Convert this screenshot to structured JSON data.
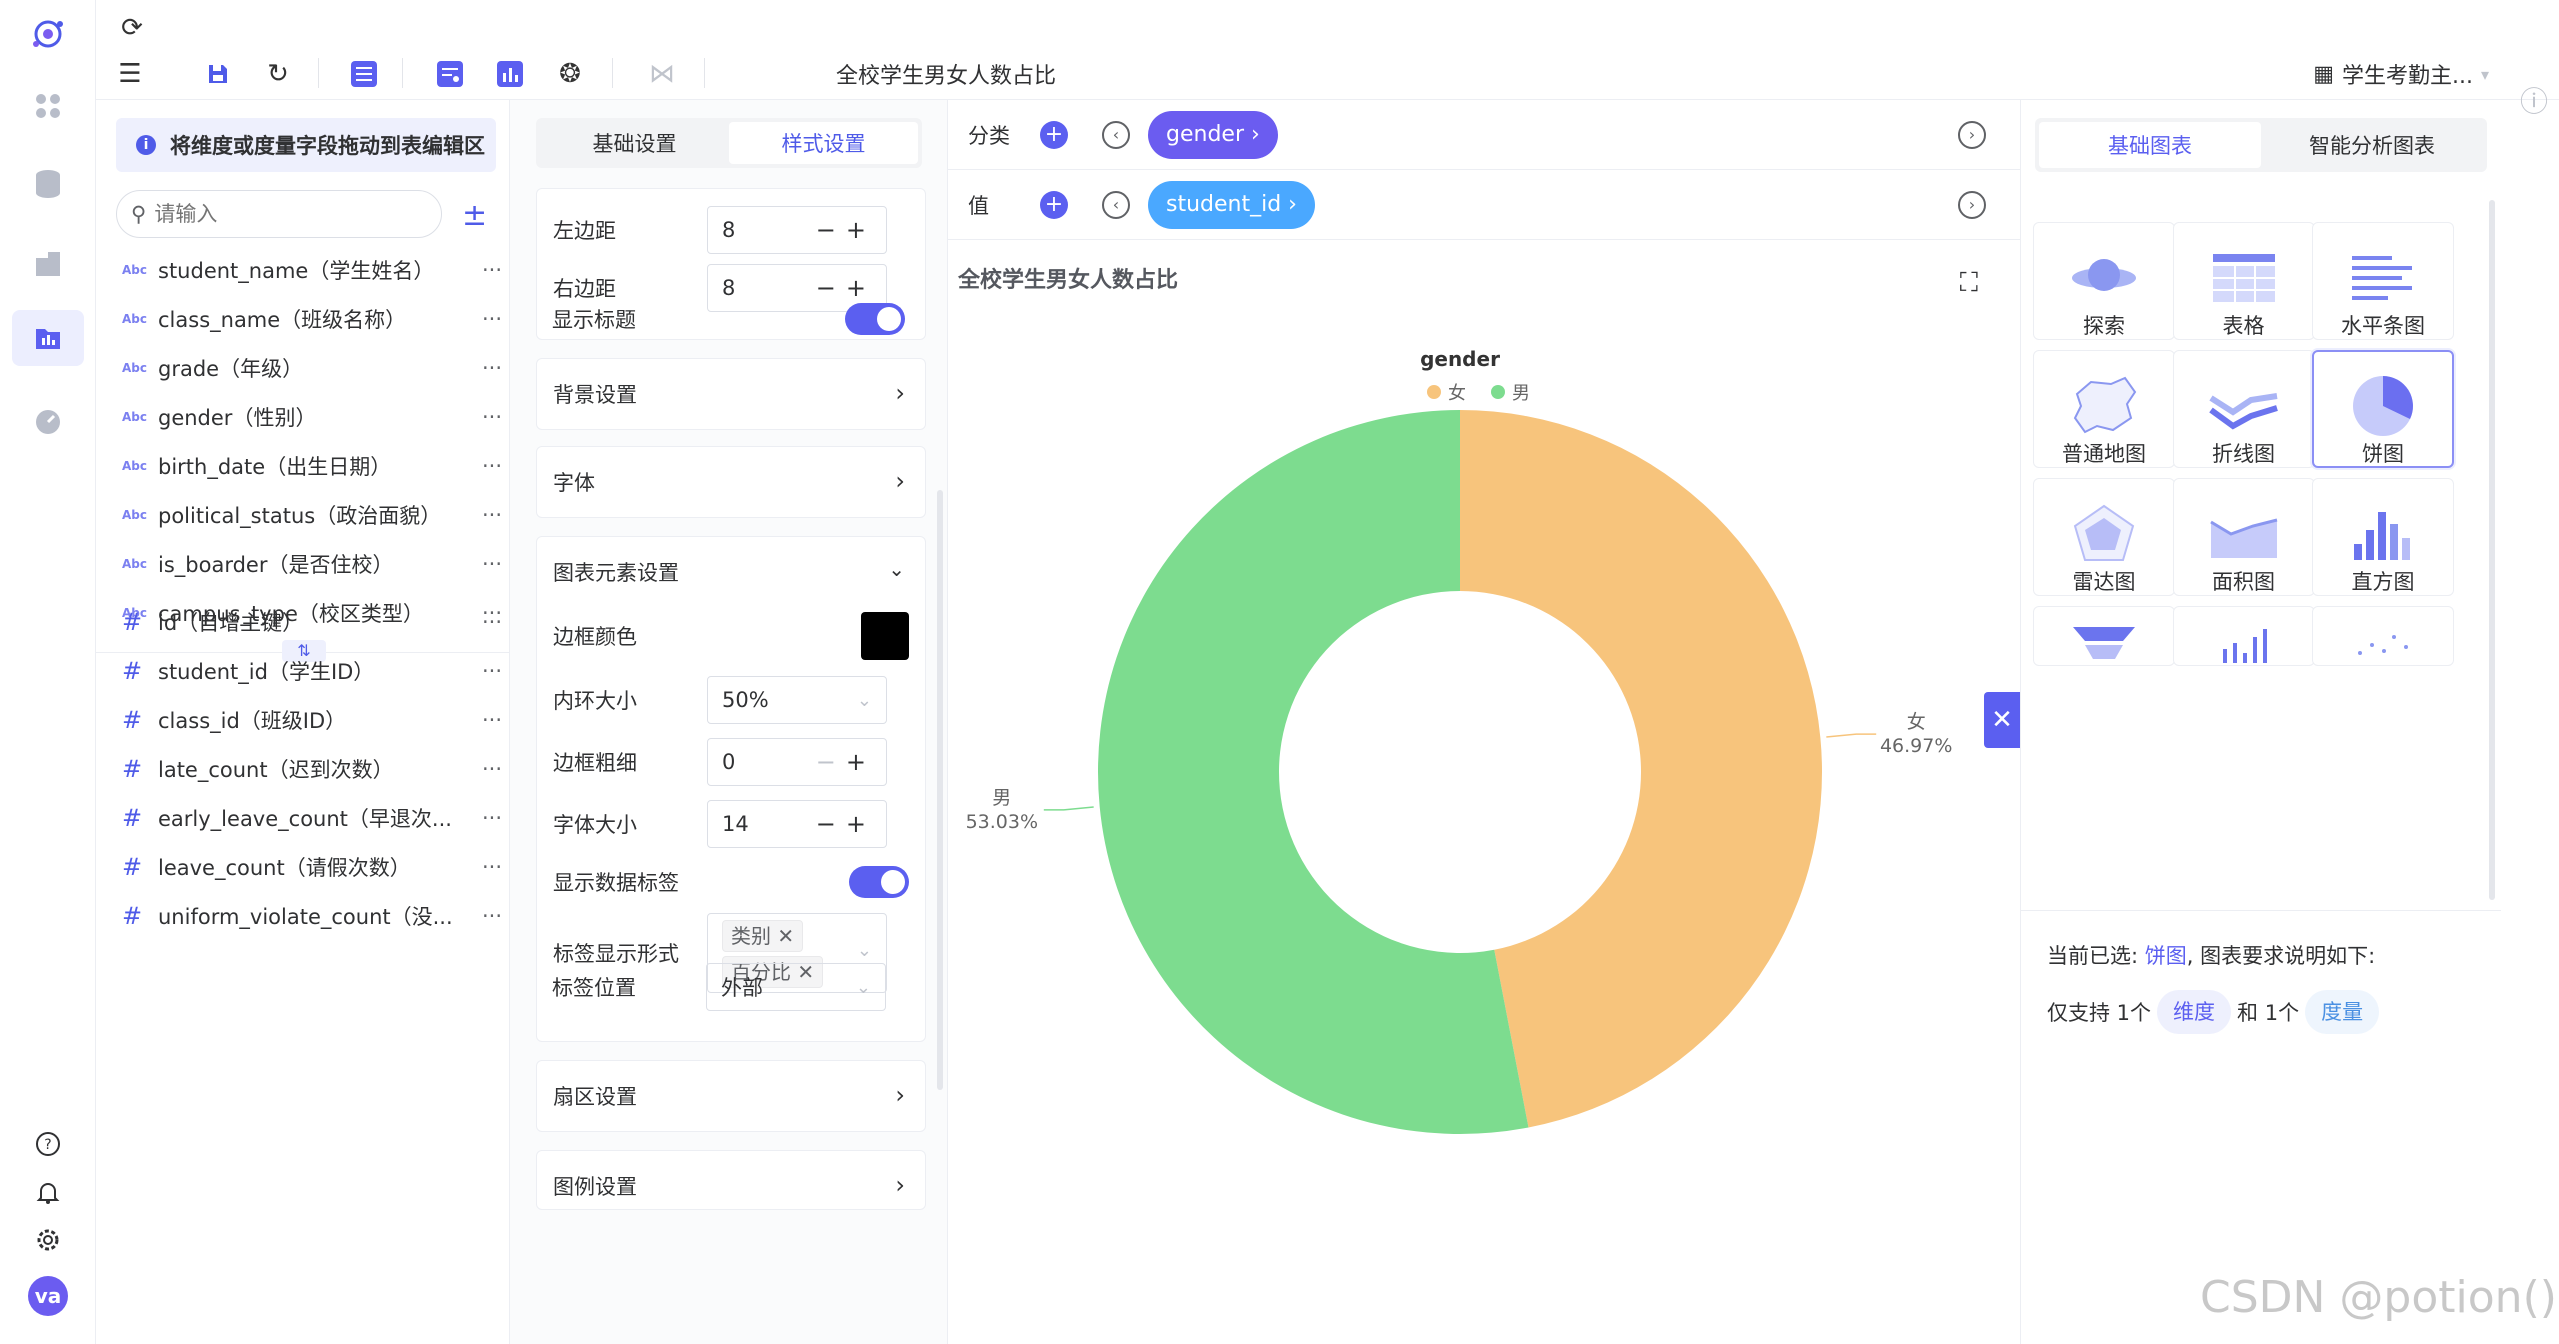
{
  "toolbar": {
    "title": "全校学生男女人数占比",
    "dataset": "学生考勤主..."
  },
  "fields": {
    "hint": "将维度或度量字段拖动到表编辑区",
    "search_placeholder": "请输入",
    "dimensions": [
      {
        "type": "Abc",
        "label": "student_name（学生姓名）"
      },
      {
        "type": "Abc",
        "label": "class_name（班级名称）"
      },
      {
        "type": "Abc",
        "label": "grade（年级）"
      },
      {
        "type": "Abc",
        "label": "gender（性别）"
      },
      {
        "type": "Abc",
        "label": "birth_date（出生日期）"
      },
      {
        "type": "Abc",
        "label": "political_status（政治面貌）"
      },
      {
        "type": "Abc",
        "label": "is_boarder（是否住校）"
      },
      {
        "type": "Abc",
        "label": "campus_type（校区类型）"
      }
    ],
    "measures": [
      {
        "type": "#",
        "label": "id（自增主键）"
      },
      {
        "type": "#",
        "label": "student_id（学生ID）"
      },
      {
        "type": "#",
        "label": "class_id（班级ID）"
      },
      {
        "type": "#",
        "label": "late_count（迟到次数）"
      },
      {
        "type": "#",
        "label": "early_leave_count（早退次..."
      },
      {
        "type": "#",
        "label": "leave_count（请假次数）"
      },
      {
        "type": "#",
        "label": "uniform_violate_count（没..."
      }
    ],
    "more": "···"
  },
  "settings": {
    "tab_basic": "基础设置",
    "tab_style": "样式设置",
    "left_margin_label": "左边距",
    "left_margin_value": "8",
    "right_margin_label": "右边距",
    "right_margin_value": "8",
    "show_title_label": "显示标题",
    "background_label": "背景设置",
    "font_label": "字体",
    "chart_elements_label": "图表元素设置",
    "border_color_label": "边框颜色",
    "inner_ring_label": "内环大小",
    "inner_ring_value": "50%",
    "border_width_label": "边框粗细",
    "border_width_value": "0",
    "font_size_label": "字体大小",
    "font_size_value": "14",
    "show_data_label": "显示数据标签",
    "label_format_label": "标签显示形式",
    "label_format_chips": [
      "类别",
      "百分比"
    ],
    "label_position_label": "标签位置",
    "label_position_value": "外部",
    "sector_label": "扇区设置",
    "legend_label": "图例设置"
  },
  "canvas": {
    "category_label": "分类",
    "value_label": "值",
    "category_field": "gender ›",
    "value_field": "student_id ›",
    "chart_title": "全校学生男女人数占比"
  },
  "chart_data": {
    "type": "pie",
    "title": "gender",
    "legend_position": "top",
    "inner_radius": "50%",
    "slices": [
      {
        "name": "女",
        "percent": 46.97,
        "label": "46.97%",
        "color": "#f7c47c"
      },
      {
        "name": "男",
        "percent": 53.03,
        "label": "53.03%",
        "color": "#7ddc8f"
      }
    ]
  },
  "types": {
    "tab_basic": "基础图表",
    "tab_ai": "智能分析图表",
    "items": [
      "探索",
      "表格",
      "水平条图",
      "普通地图",
      "折线图",
      "饼图",
      "雷达图",
      "面积图",
      "直方图"
    ],
    "current_prefix": "当前已选: ",
    "current_value": "饼图",
    "current_suffix": ", 图表要求说明如下:",
    "req_prefix": "仅支持 1个",
    "req_dim": "维度",
    "req_mid": "和 1个",
    "req_mea": "度量"
  },
  "watermark": "CSDN @potion()",
  "colors": {
    "accent": "#5b5ff0",
    "female": "#f7c47c",
    "male": "#7ddc8f",
    "value_pill": "#4aa8ff"
  }
}
